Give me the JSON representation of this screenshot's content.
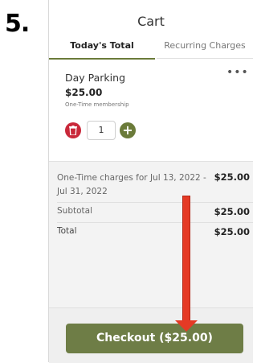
{
  "step_number": "5.",
  "cart": {
    "title": "Cart",
    "tabs": [
      {
        "label": "Today's Total",
        "active": true
      },
      {
        "label": "Recurring Charges",
        "active": false
      }
    ]
  },
  "item": {
    "name": "Day Parking",
    "price": "$25.00",
    "subtitle": "One-Time membership",
    "quantity": "1",
    "more_icon": "more-horizontal-icon",
    "delete_icon": "trash-icon",
    "add_icon": "plus-icon"
  },
  "summary": {
    "charges_label": "One-Time charges for Jul 13, 2022 - Jul 31, 2022",
    "charges_amount": "$25.00",
    "subtotal_label": "Subtotal",
    "subtotal_amount": "$25.00",
    "total_label": "Total",
    "total_amount": "$25.00"
  },
  "checkout": {
    "label": "Checkout ($25.00)"
  },
  "colors": {
    "accent": "#6e7d46",
    "delete": "#c9283a",
    "annotation_arrow": "#e53a25"
  }
}
